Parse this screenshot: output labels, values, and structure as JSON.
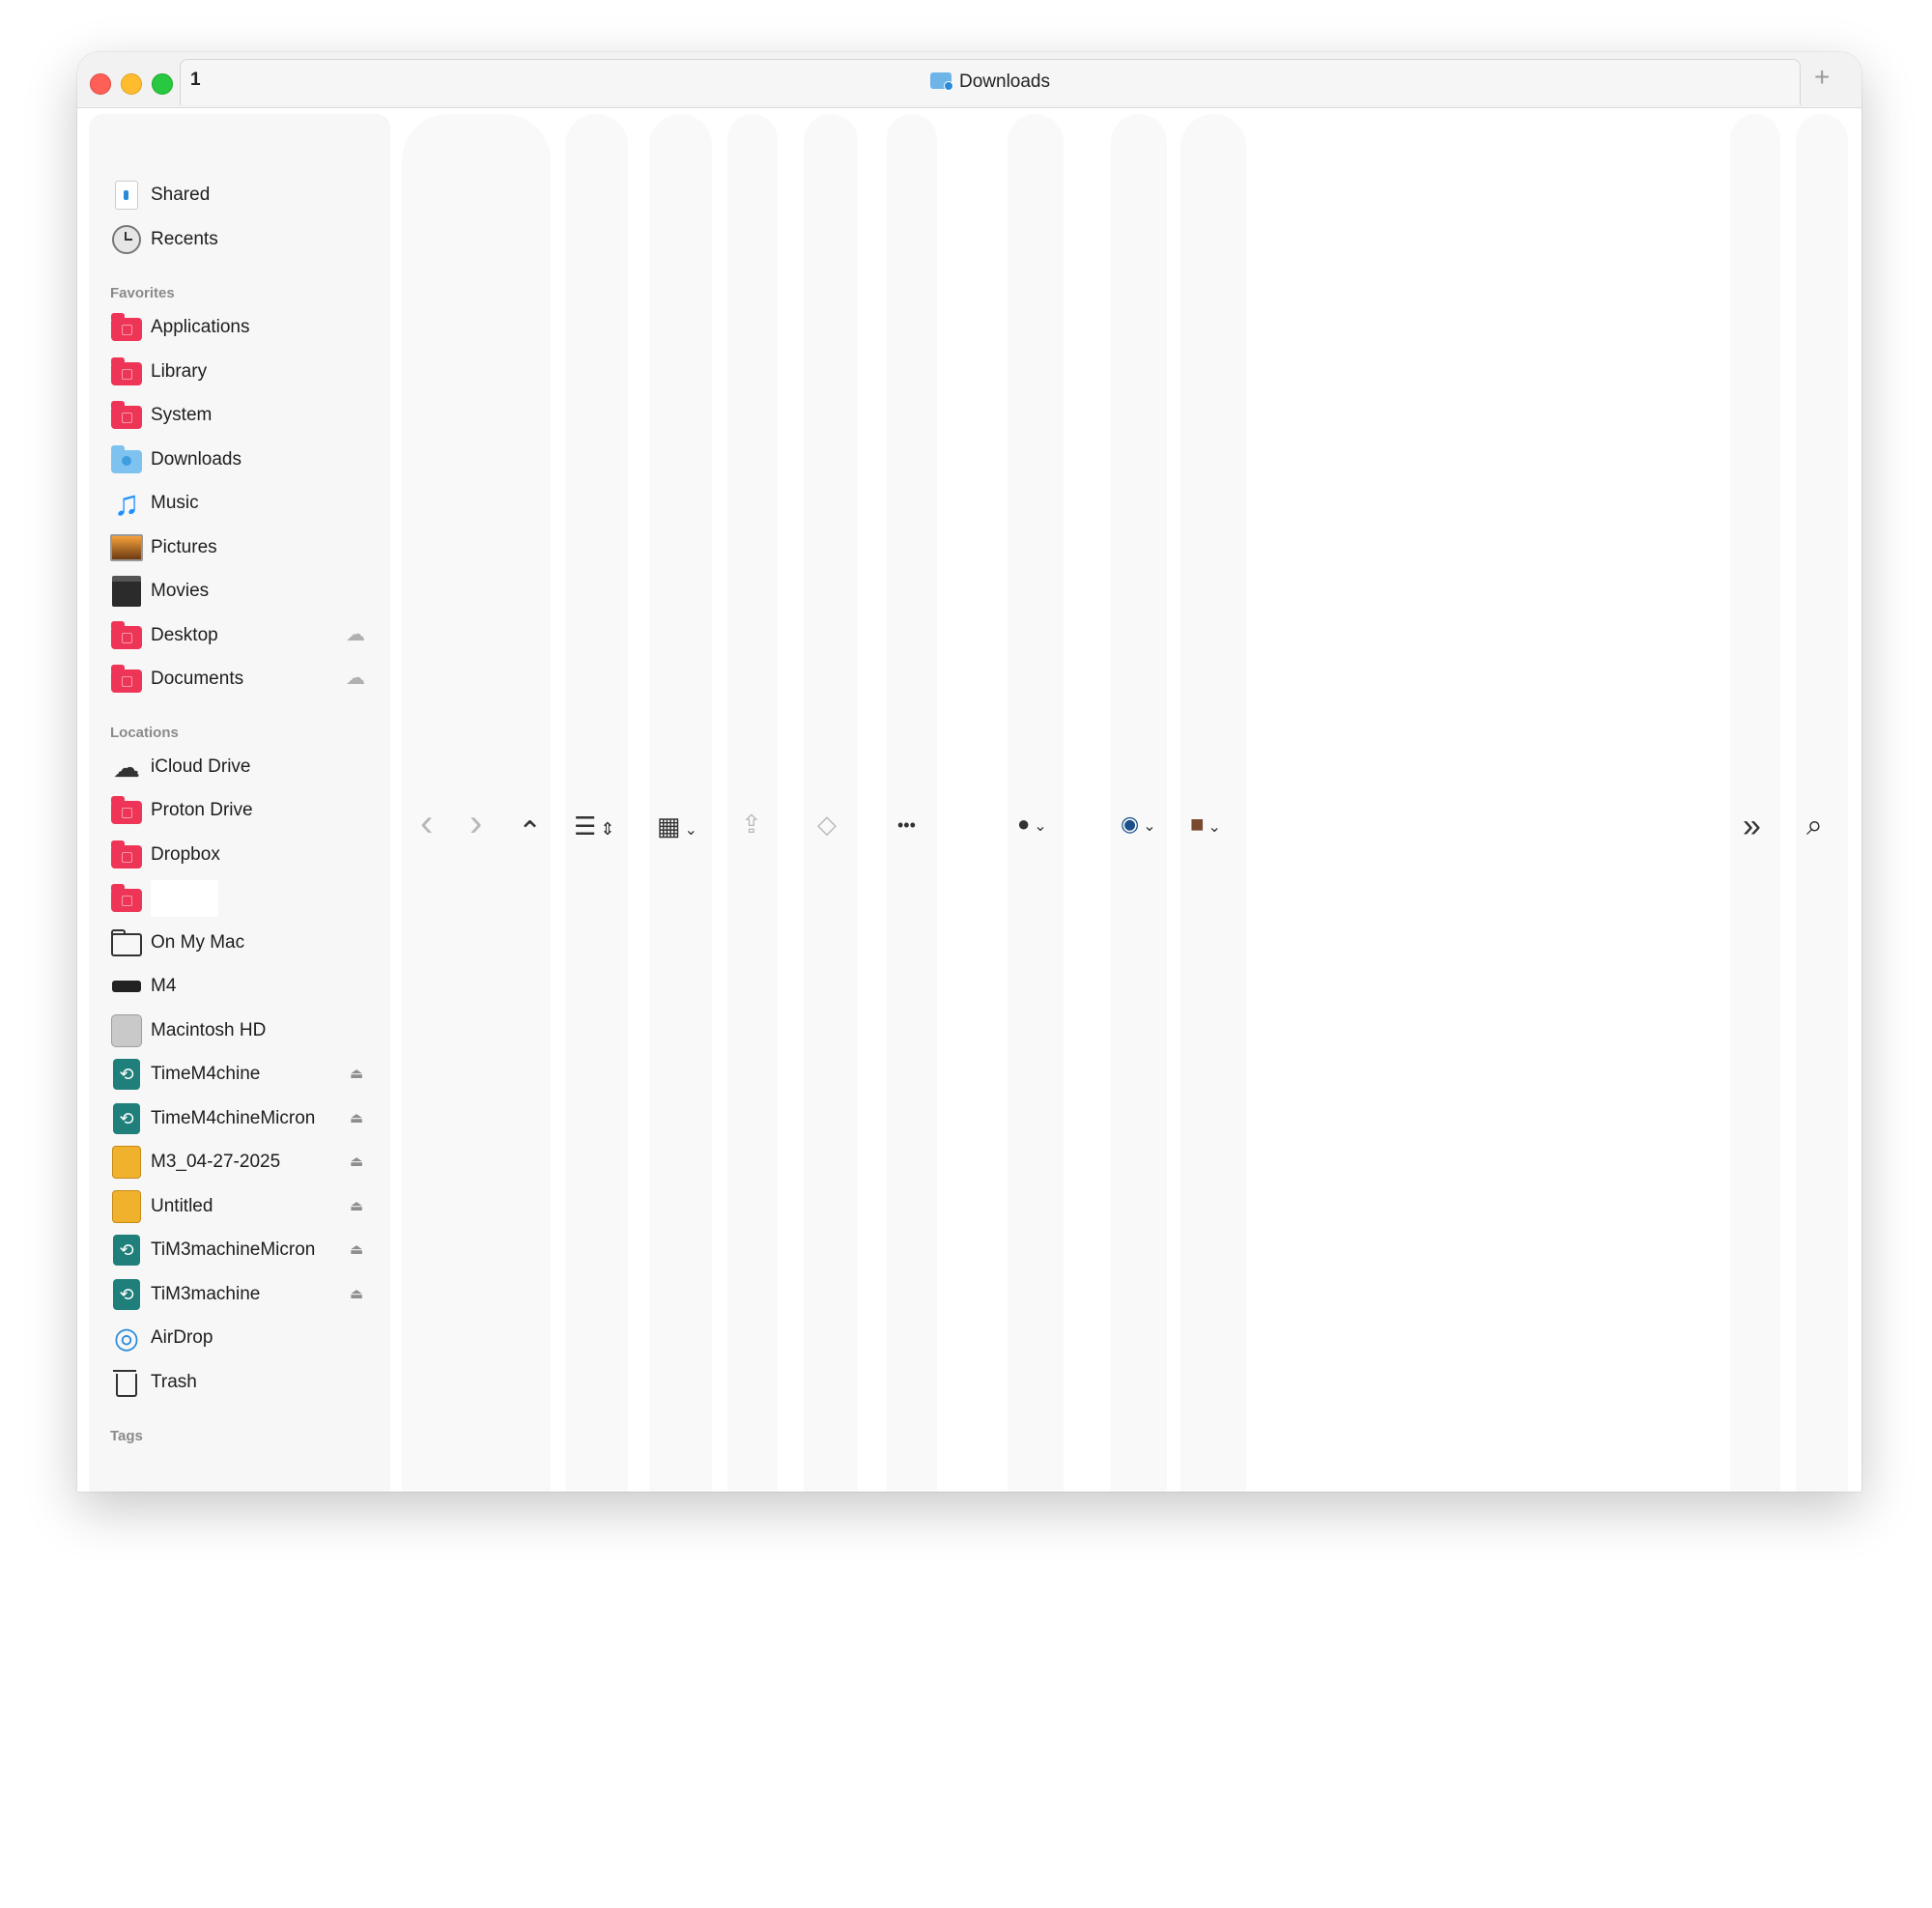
{
  "window": {
    "tab_number": "1",
    "tab_title": "Downloads",
    "new_tab_symbol": "+"
  },
  "sidebar": {
    "top_items": [
      {
        "label": "Shared",
        "icon": "shared-icon"
      },
      {
        "label": "Recents",
        "icon": "clock-icon"
      }
    ],
    "favorites_header": "Favorites",
    "favorites": [
      {
        "label": "Applications",
        "icon": "applications-folder-icon"
      },
      {
        "label": "Library",
        "icon": "library-folder-icon"
      },
      {
        "label": "System",
        "icon": "system-folder-icon"
      },
      {
        "label": "Downloads",
        "icon": "downloads-folder-icon"
      },
      {
        "label": "Music",
        "icon": "music-note-icon"
      },
      {
        "label": "Pictures",
        "icon": "pictures-icon"
      },
      {
        "label": "Movies",
        "icon": "clapperboard-icon"
      },
      {
        "label": "Desktop",
        "icon": "desktop-folder-icon",
        "badge": "cloud-icon"
      },
      {
        "label": "Documents",
        "icon": "documents-folder-icon",
        "badge": "cloud-icon"
      }
    ],
    "locations_header": "Locations",
    "locations": [
      {
        "label": "iCloud Drive",
        "icon": "cloud-icon"
      },
      {
        "label": "Proton Drive",
        "icon": "folder-icon"
      },
      {
        "label": "Dropbox",
        "icon": "folder-icon"
      },
      {
        "label": "",
        "icon": "camera-folder-icon"
      },
      {
        "label": "On My Mac",
        "icon": "folder-outline-icon"
      },
      {
        "label": "M4",
        "icon": "drive-icon"
      },
      {
        "label": "Macintosh HD",
        "icon": "hard-disk-icon"
      },
      {
        "label": "TimeM4chine",
        "icon": "time-machine-icon",
        "badge": "eject-icon"
      },
      {
        "label": "TimeM4chineMicron",
        "icon": "time-machine-icon",
        "badge": "eject-icon"
      },
      {
        "label": "M3_04-27-2025",
        "icon": "external-drive-icon",
        "badge": "eject-icon"
      },
      {
        "label": "Untitled",
        "icon": "external-drive-icon",
        "badge": "eject-icon"
      },
      {
        "label": "TiM3machineMicron",
        "icon": "time-machine-icon",
        "badge": "eject-icon"
      },
      {
        "label": "TiM3machine",
        "icon": "time-machine-icon",
        "badge": "eject-icon"
      },
      {
        "label": "AirDrop",
        "icon": "airdrop-icon"
      },
      {
        "label": "Trash",
        "icon": "trash-icon"
      }
    ],
    "tags_header": "Tags"
  },
  "toolbar": {
    "back": "‹",
    "forward": "›",
    "up": "⌃",
    "list_view": "☰",
    "grid_view": "▦",
    "share": "⇪",
    "tag": "◇",
    "more": "•••",
    "extension_1": "●",
    "extension_2": "◉",
    "extension_3": "■",
    "overflow": "»",
    "search": "⌕"
  }
}
